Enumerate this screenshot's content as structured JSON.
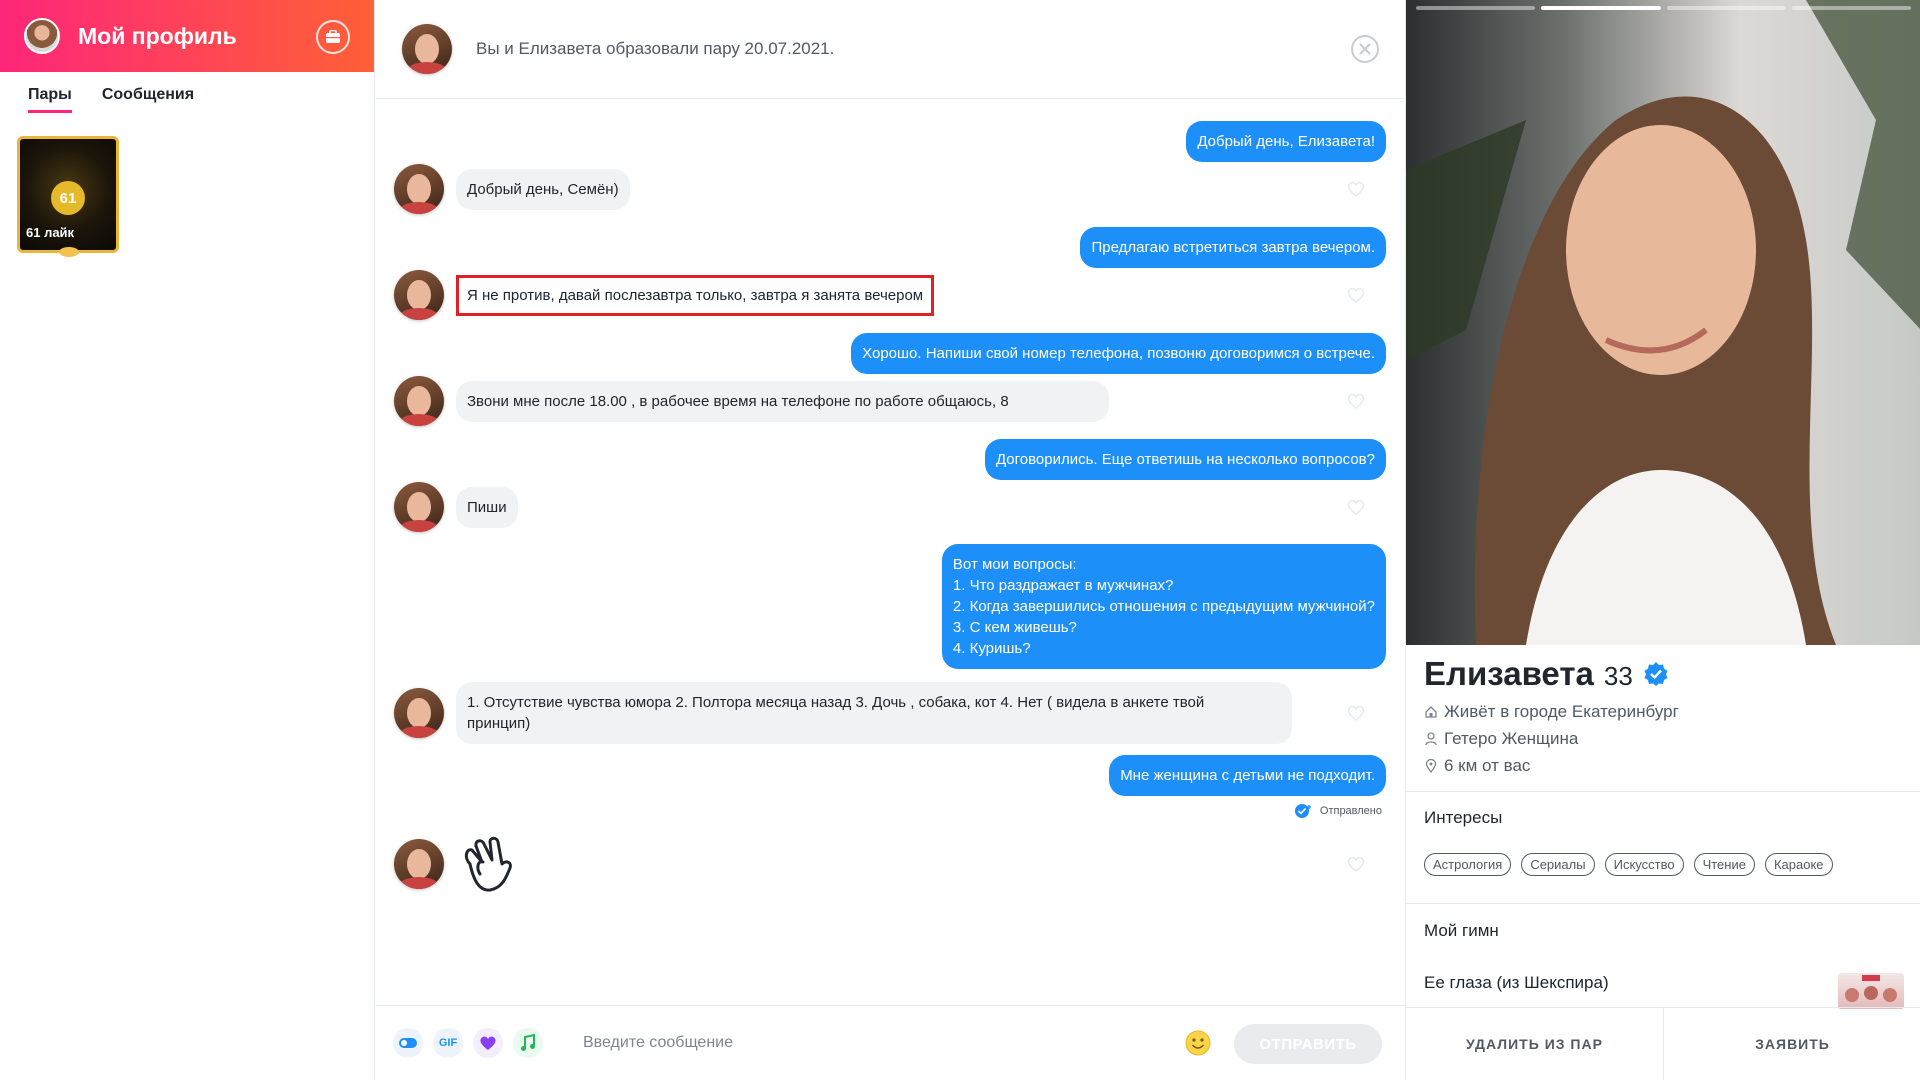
{
  "sidebar": {
    "title": "Мой профиль",
    "tabs": [
      "Пары",
      "Сообщения"
    ],
    "likes": {
      "count": "61",
      "label": "61 лайк"
    }
  },
  "chat": {
    "header": "Вы и Елизавета образовали пару 20.07.2021.",
    "messages": [
      {
        "dir": "out",
        "text": "Добрый день, Елизавета!"
      },
      {
        "dir": "in",
        "text": "Добрый день,  Семён)"
      },
      {
        "dir": "out",
        "text": "Предлагаю встретиться завтра вечером."
      },
      {
        "dir": "in",
        "text": "Я не против, давай послезавтра только, завтра я занята вечером",
        "highlighted": true
      },
      {
        "dir": "out",
        "text": "Хорошо. Напиши свой номер телефона, позвоню договоримся о встрече."
      },
      {
        "dir": "in",
        "text": "Звони мне после 18.00 , в рабочее время на телефоне по работе общаюсь, 8"
      },
      {
        "dir": "out",
        "text": "Договорились. Еще ответишь на несколько вопросов?"
      },
      {
        "dir": "in",
        "text": "Пиши"
      },
      {
        "dir": "out",
        "text": "Вот мои вопросы:\n1. Что раздражает в мужчинах?\n2. Когда завершились отношения с предыдущим мужчиной?\n3. С кем живешь?\n4. Куришь?"
      },
      {
        "dir": "in",
        "text": "1. Отсутствие чувства юмора 2. Полтора месяца назад  3. Дочь , собака, кот 4. Нет ( видела в анкете твой\nпринцип)"
      },
      {
        "dir": "out",
        "text": "Мне женщина с детьми не подходит."
      },
      {
        "dir": "in",
        "text": "",
        "sticker": "waving-hands"
      }
    ],
    "status": "Отправлено",
    "composer": {
      "gif_label": "GIF",
      "placeholder": "Введите сообщение",
      "send_label": "ОТПРАВИТЬ"
    }
  },
  "profile": {
    "name": "Елизавета",
    "age": "33",
    "verified": true,
    "city": "Живёт в городе Екатеринбург",
    "orientation": "Гетеро Женщина",
    "distance": "6 км от вас",
    "interests_title": "Интересы",
    "interests": [
      "Астрология",
      "Сериалы",
      "Искусство",
      "Чтение",
      "Караоке"
    ],
    "anthem_title": "Мой гимн",
    "song": "Ее глаза (из Шекспира)",
    "actions": {
      "unmatch": "УДАЛИТЬ ИЗ ПАР",
      "report": "ЗАЯВИТЬ"
    }
  },
  "colors": {
    "brand_start": "#fd267a",
    "brand_end": "#ff6036",
    "outgoing": "#1d8ff8",
    "incoming": "#f0f2f4",
    "highlight": "#e01f26"
  }
}
